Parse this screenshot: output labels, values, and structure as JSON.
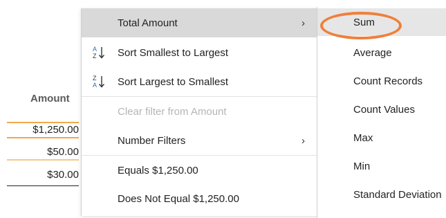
{
  "sheet": {
    "column_header": "Amount",
    "cells": [
      "$1,250.00",
      "$50.00",
      "$30.00"
    ]
  },
  "menu": {
    "items": [
      {
        "label": "Total Amount",
        "has_submenu": true
      },
      {
        "label": "Sort Smallest to Largest",
        "icon": "sort-ascending-icon"
      },
      {
        "label": "Sort Largest to Smallest",
        "icon": "sort-descending-icon"
      },
      {
        "label": "Clear filter from Amount",
        "disabled": true
      },
      {
        "label": "Number Filters",
        "has_submenu": true
      },
      {
        "label": "Equals $1,250.00"
      },
      {
        "label": "Does Not Equal $1,250.00"
      }
    ],
    "chevron": "›"
  },
  "submenu": {
    "items": [
      {
        "label": "Sum"
      },
      {
        "label": "Average"
      },
      {
        "label": "Count Records"
      },
      {
        "label": "Count Values"
      },
      {
        "label": "Max"
      },
      {
        "label": "Min"
      },
      {
        "label": "Standard Deviation"
      }
    ]
  },
  "colors": {
    "highlight_ring": "#ef7f3b",
    "selected_border": "#f0a94a"
  }
}
